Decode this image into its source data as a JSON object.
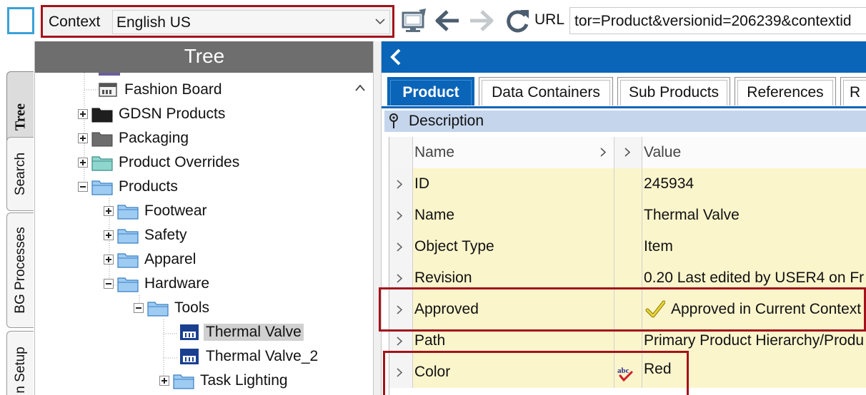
{
  "toolbar": {
    "context_label": "Context",
    "context_value": "English US",
    "url_label": "URL",
    "url_value": "tor=Product&versionid=206239&contextid",
    "icons": [
      "app-square-icon",
      "monitor-icon",
      "back-arrow-icon",
      "forward-arrow-icon",
      "refresh-icon"
    ]
  },
  "sidebar_tabs": {
    "tree": "Tree",
    "search": "Search",
    "bg_processes": "BG Processes",
    "setup": "n Setup"
  },
  "tree": {
    "title": "Tree",
    "nodes": [
      {
        "label": "Fashion Board",
        "icon": "board-icon"
      },
      {
        "label": "GDSN Products",
        "icon": "folder-black-icon"
      },
      {
        "label": "Packaging",
        "icon": "folder-gray-icon"
      },
      {
        "label": "Product Overrides",
        "icon": "folder-teal-icon"
      },
      {
        "label": "Products",
        "icon": "folder-blue-icon"
      },
      {
        "label": "Footwear",
        "icon": "folder-blue-icon"
      },
      {
        "label": "Safety",
        "icon": "folder-blue-icon"
      },
      {
        "label": "Apparel",
        "icon": "folder-blue-icon"
      },
      {
        "label": "Hardware",
        "icon": "folder-blue-icon"
      },
      {
        "label": "Tools",
        "icon": "folder-blue-icon"
      },
      {
        "label": "Thermal Valve",
        "icon": "product-item-icon"
      },
      {
        "label": "Thermal Valve_2",
        "icon": "product-item-icon"
      },
      {
        "label": "Task Lighting",
        "icon": "folder-blue-icon"
      }
    ]
  },
  "editor": {
    "tabs": [
      "Product",
      "Data Containers",
      "Sub Products",
      "References",
      "R"
    ],
    "section_title": "Description",
    "columns": {
      "name": "Name",
      "value": "Value"
    },
    "rows": [
      {
        "name": "ID",
        "value": "245934"
      },
      {
        "name": "Name",
        "value": "Thermal Valve"
      },
      {
        "name": "Object Type",
        "value": "Item"
      },
      {
        "name": "Revision",
        "value": "0.20 Last edited by USER4 on Fr"
      },
      {
        "name": "Approved",
        "value": "Approved in Current Context"
      },
      {
        "name": "Path",
        "value": "Primary Product Hierarchy/Produ"
      },
      {
        "name": "Color",
        "value": "Red"
      }
    ]
  },
  "colors": {
    "accent_blue": "#0a64b8",
    "highlight_red": "#a3121b",
    "tree_header": "#6e6e6e",
    "row_yellow": "#fbf5cc"
  }
}
